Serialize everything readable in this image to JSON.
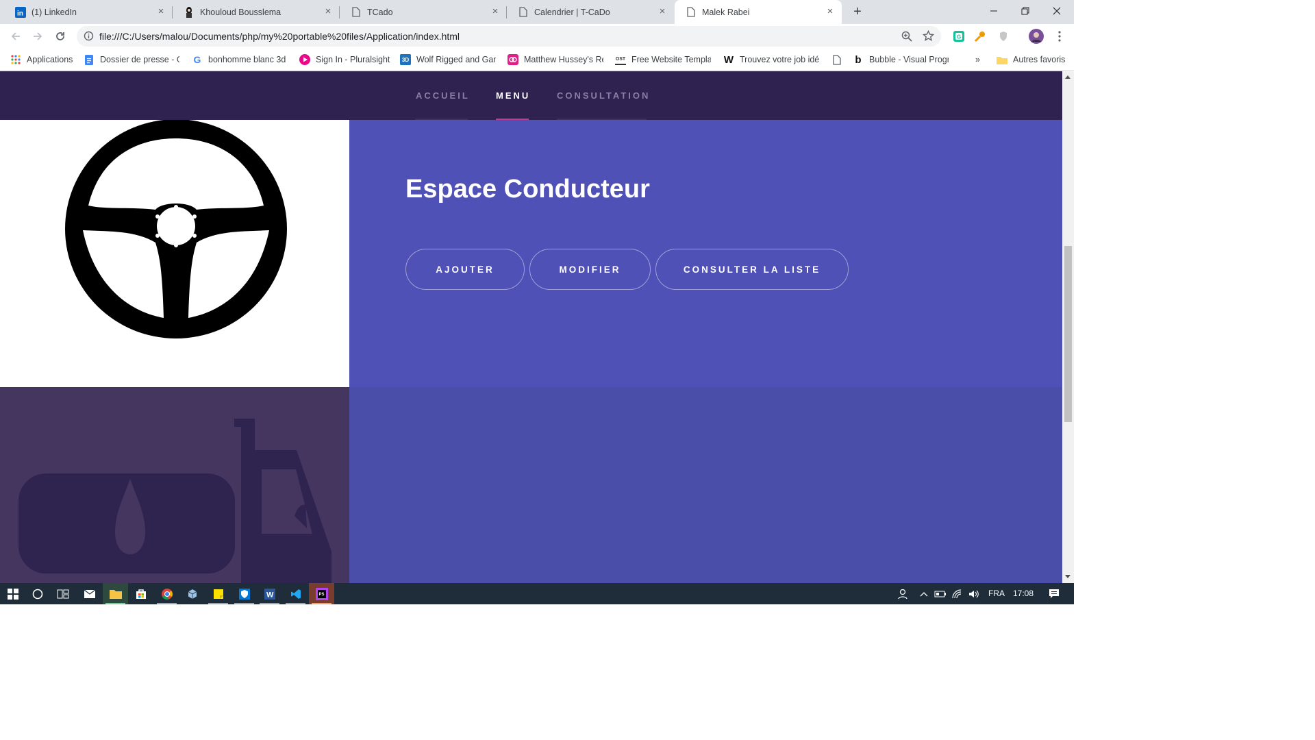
{
  "browser": {
    "tabs": [
      {
        "title": "(1) LinkedIn",
        "icon": "linkedin-icon"
      },
      {
        "title": "Khouloud Bousslema",
        "icon": "profile-icon"
      },
      {
        "title": "TCado",
        "icon": "page-icon"
      },
      {
        "title": "Calendrier | T-CaDo",
        "icon": "page-icon"
      },
      {
        "title": "Malek Rabei",
        "icon": "page-icon",
        "active": true
      }
    ],
    "address": "file:///C:/Users/malou/Documents/php/my%20portable%20files/Application/index.html",
    "bookmarks": [
      {
        "label": "Applications",
        "icon": "apps-grid-icon"
      },
      {
        "label": "Dossier de presse - G",
        "icon": "docs-icon"
      },
      {
        "label": "bonhomme blanc 3d",
        "icon": "google-icon"
      },
      {
        "label": "Sign In - Pluralsight",
        "icon": "pluralsight-icon"
      },
      {
        "label": "Wolf Rigged and Gan",
        "icon": "3d-icon"
      },
      {
        "label": "Matthew Hussey's Re",
        "icon": "mh-icon"
      },
      {
        "label": "Free Website Templat",
        "icon": "ost-icon"
      },
      {
        "label": "Trouvez votre job idé",
        "icon": "w-icon"
      },
      {
        "label": "",
        "icon": "page-icon"
      },
      {
        "label": "Bubble - Visual Progr",
        "icon": "bubble-icon"
      }
    ],
    "bookmarks_more": "»",
    "other_bookmarks": "Autres favoris"
  },
  "site": {
    "nav": [
      {
        "label": "ACCUEIL",
        "active": false
      },
      {
        "label": "MENU",
        "active": true
      },
      {
        "label": "CONSULTATION",
        "active": false
      }
    ],
    "section_title": "Espace Conducteur",
    "buttons": [
      "AJOUTER",
      "MODIFIER",
      "CONSULTER LA LISTE"
    ]
  },
  "taskbar": {
    "language": "FRA",
    "time": "17:08"
  },
  "colors": {
    "nav_bg": "#2f2250",
    "nav_accent": "#c0398f",
    "panel_blue": "#5051b6",
    "panel_blue_lower": "#4a4ea9",
    "fuel_bg": "#45365f"
  }
}
